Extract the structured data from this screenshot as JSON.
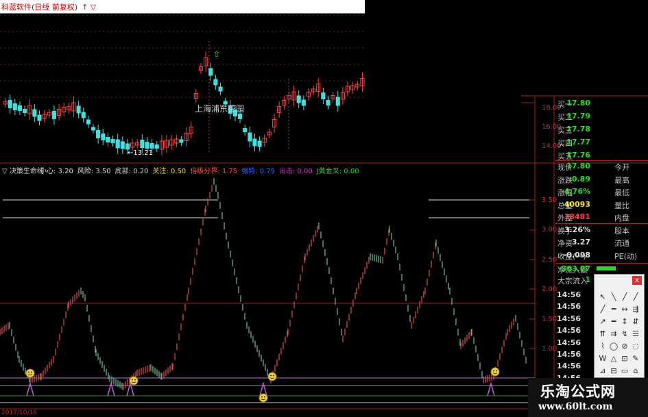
{
  "window": {
    "title": "科蓝软件(日线 前复权)",
    "title_icons": "↑ ▽"
  },
  "price_chart": {
    "low_label": "←13.21",
    "annotation": "上海浦东花园",
    "y_ticks": [
      "18.00",
      "16.00",
      "14.00"
    ]
  },
  "indicator": {
    "name": "决策生命线",
    "items": [
      {
        "label": "小心: 3.20",
        "color": "#e0e0e0"
      },
      {
        "label": "风险: 3.50",
        "color": "#e0e0e0"
      },
      {
        "label": "底部: 0.20",
        "color": "#d0d0d0"
      },
      {
        "label": "关注: 0.50",
        "color": "#f0e020"
      },
      {
        "label": "倍级分界: 1.75",
        "color": "#ff5050"
      },
      {
        "label": "强势: 0.79",
        "color": "#4060ff"
      },
      {
        "label": "出击: 0.00",
        "color": "#c040c0"
      },
      {
        "label": "J黄金叉: 0.00",
        "color": "#30d030"
      }
    ],
    "y_ticks": [
      "3.50",
      "3.00",
      "2.50",
      "2.00",
      "1.50",
      "1.00"
    ]
  },
  "quote": {
    "bids": [
      {
        "label": "买一",
        "value": "17.80"
      },
      {
        "label": "买二",
        "value": "17.79"
      },
      {
        "label": "买三",
        "value": "17.78"
      },
      {
        "label": "买四",
        "value": "17.77"
      },
      {
        "label": "买五",
        "value": "17.76"
      }
    ],
    "stats": [
      {
        "label": "现价",
        "value": "17.80",
        "extra": "今开",
        "color": "#20e020"
      },
      {
        "label": "涨跌",
        "value": "-0.89",
        "extra": "最高",
        "color": "#20e020"
      },
      {
        "label": "涨幅",
        "value": "-4.76%",
        "extra": "最低",
        "color": "#20e020"
      },
      {
        "label": "总量",
        "value": "40093",
        "extra": "量比",
        "color": "#f0e020"
      },
      {
        "label": "外盘",
        "value": "18481",
        "extra": "内盘",
        "color": "#ff4040"
      },
      {
        "label": "换手",
        "value": "3.26%",
        "extra": "股本",
        "color": "#e0e0e0"
      },
      {
        "label": "净资",
        "value": "3.27",
        "extra": "流通",
        "color": "#e0e0e0"
      },
      {
        "label": "收益(一)",
        "value": "-0.098",
        "extra": "PE(动)",
        "color": "#e0e0e0"
      }
    ],
    "flow": [
      {
        "label": "净流入额",
        "value": "-303.07"
      },
      {
        "label": "大宗流入",
        "value": "1"
      }
    ],
    "times": [
      "14:56",
      "14:56",
      "14:56",
      "14:56",
      "14:56",
      "14:56",
      "14:56",
      "14:56"
    ]
  },
  "bottom_date": "2017/10/16",
  "tools": {
    "close": "x",
    "glyphs": [
      "↖",
      "╲",
      "╱",
      "╱",
      "╱",
      "═",
      "↔",
      "⇶",
      "↗",
      "━",
      "↕",
      "⇵",
      "⇈",
      "⇉",
      "↯",
      "☰",
      "⌇",
      "◯",
      "⊘",
      "◌",
      "W",
      "△",
      "⊡",
      "✎",
      "⊿",
      "⊟",
      "▭",
      "⌂"
    ]
  },
  "watermark": {
    "title": "乐淘公式网",
    "url": "www.60lt.com"
  }
}
